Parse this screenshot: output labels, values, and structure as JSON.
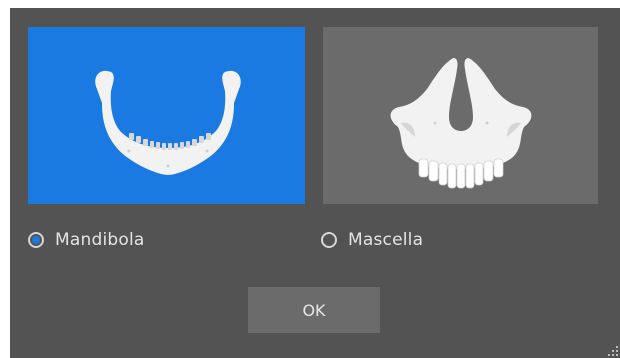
{
  "dialog": {
    "options": [
      {
        "id": "mandibola",
        "label": "Mandibola",
        "selected": true,
        "image_icon": "mandible-jaw-icon"
      },
      {
        "id": "mascella",
        "label": "Mascella",
        "selected": false,
        "image_icon": "maxilla-jaw-icon"
      }
    ],
    "ok_label": "OK"
  },
  "colors": {
    "dialog_background": "#535353",
    "selected_card": "#1b7ae2",
    "unselected_card": "#6b6b6b",
    "bone": "#f2f2f2",
    "button": "#6b6b6b",
    "text": "#e4e4e4"
  }
}
